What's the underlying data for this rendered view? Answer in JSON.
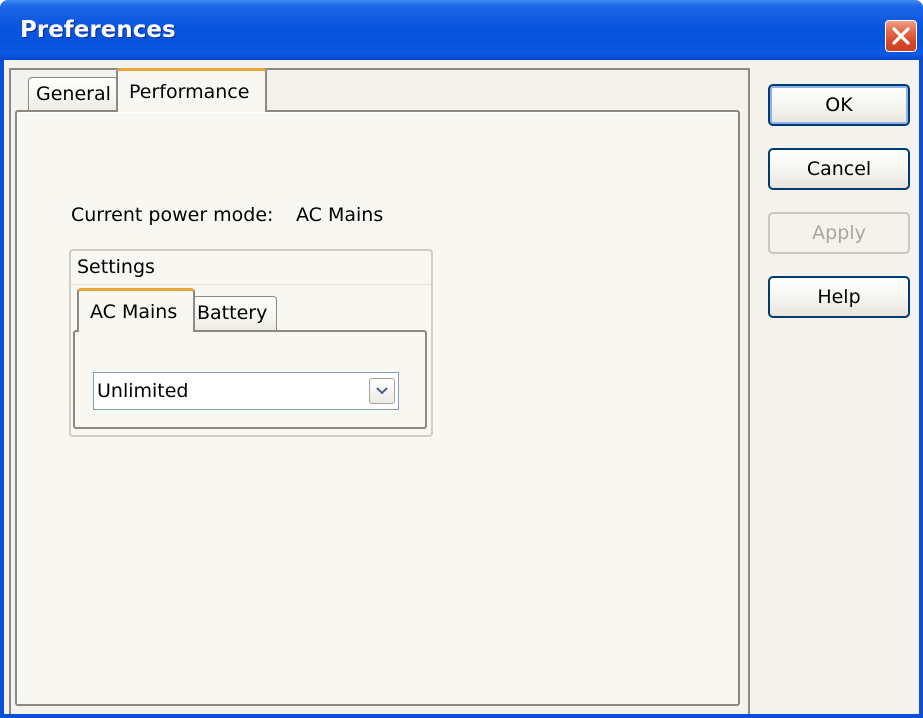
{
  "window": {
    "title": "Preferences",
    "close_icon": "close-icon"
  },
  "tabs": [
    {
      "label": "General",
      "selected": false
    },
    {
      "label": "Performance",
      "selected": true
    }
  ],
  "performance": {
    "power_mode_label": "Current power mode:",
    "power_mode_value": "AC Mains",
    "settings": {
      "title": "Settings",
      "tabs": [
        {
          "label": "AC Mains",
          "selected": true
        },
        {
          "label": "Battery",
          "selected": false
        }
      ],
      "dropdown": {
        "selected_value": "Unlimited",
        "icon": "chevron-down-icon"
      }
    }
  },
  "buttons": {
    "ok": "OK",
    "cancel": "Cancel",
    "apply": "Apply",
    "apply_enabled": false,
    "help": "Help"
  },
  "colors": {
    "titlebar_blue": "#0a55de",
    "close_red": "#d5482a",
    "selected_tab_accent": "#e7a53a",
    "dialog_background": "#f4f2ec"
  }
}
